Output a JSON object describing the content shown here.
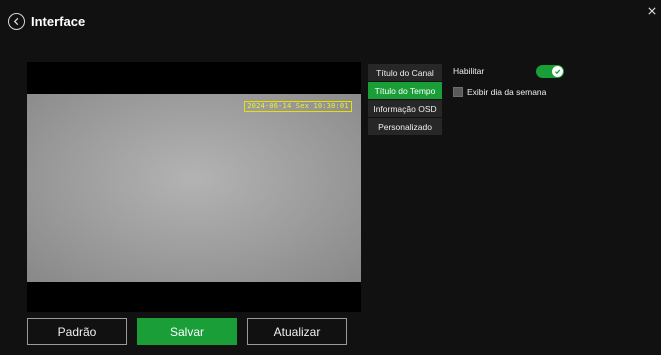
{
  "header": {
    "title": "Interface"
  },
  "preview": {
    "osd_text": "2024-06-14 Sex 10:30:01",
    "osd_color": "#e8e000"
  },
  "tabs": [
    {
      "label": "Título do Canal",
      "active": false
    },
    {
      "label": "Título do Tempo",
      "active": true
    },
    {
      "label": "Informação OSD",
      "active": false
    },
    {
      "label": "Personalizado",
      "active": false
    }
  ],
  "settings": {
    "enable_label": "Habilitar",
    "enable_on": true,
    "weekday_label": "Exibir dia da semana",
    "weekday_checked": false
  },
  "buttons": {
    "default_label": "Padrão",
    "save_label": "Salvar",
    "refresh_label": "Atualizar"
  },
  "colors": {
    "accent": "#1a9e38",
    "background": "#111111",
    "tab_bg": "#272727"
  }
}
